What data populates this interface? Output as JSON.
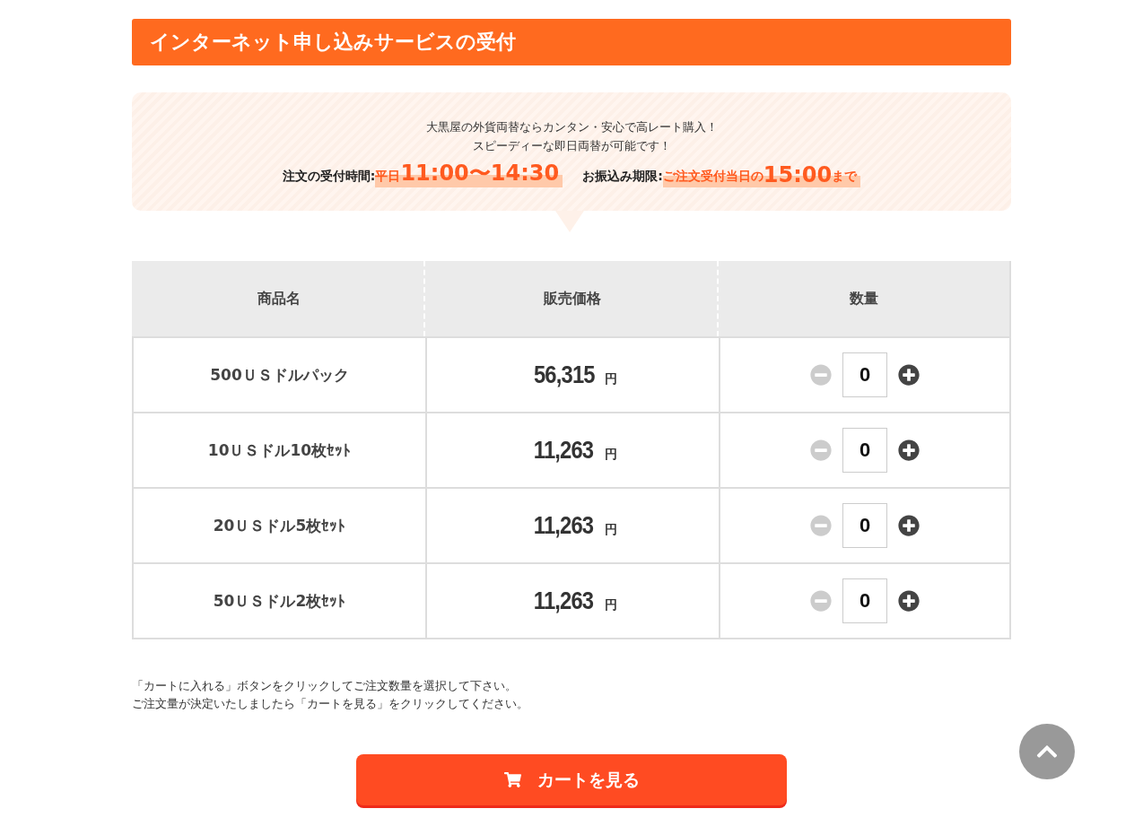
{
  "heading": "インターネット申し込みサービスの受付",
  "info": {
    "lines": [
      "大黒屋の外貨両替ならカンタン・安心で高レート購入！",
      "スピーディーな即日両替が可能です！"
    ],
    "hours": [
      {
        "label": "注文の受付時間:",
        "parts": [
          {
            "kind": "small",
            "text": "平日"
          },
          {
            "kind": "big",
            "text": "11:00〜14:30"
          }
        ]
      },
      {
        "label": "お振込み期限:",
        "parts": [
          {
            "kind": "small",
            "text": "ご注文受付当日の"
          },
          {
            "kind": "big",
            "text": "15:00"
          },
          {
            "kind": "small",
            "text": "まで"
          }
        ]
      }
    ]
  },
  "table": {
    "columns": [
      "商品名",
      "販売価格",
      "数量"
    ],
    "rows": [
      {
        "name": "500ＵＳドルパック",
        "price": "56,315",
        "unit": "円",
        "quantity": "0",
        "decrease_disabled": true
      },
      {
        "name": "10ＵＳドル10枚ｾｯﾄ",
        "price": "11,263",
        "unit": "円",
        "quantity": "0",
        "decrease_disabled": true
      },
      {
        "name": "20ＵＳドル5枚ｾｯﾄ",
        "price": "11,263",
        "unit": "円",
        "quantity": "0",
        "decrease_disabled": true
      },
      {
        "name": "50ＵＳドル2枚ｾｯﾄ",
        "price": "11,263",
        "unit": "円",
        "quantity": "0",
        "decrease_disabled": true
      }
    ]
  },
  "notes": [
    "「カートに入れる」ボタンをクリックしてご注文数量を選択して下さい。",
    "ご注文量が決定いたしましたら「カートを見る」をクリックしてください。"
  ],
  "cart_button": "カートを見る"
}
